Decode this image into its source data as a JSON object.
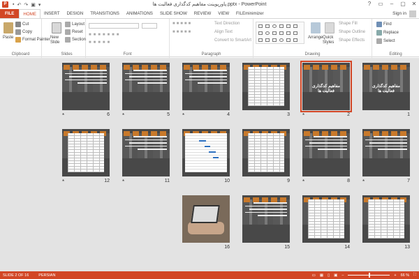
{
  "window": {
    "title": "پاورپوینت مفاهیم کدگذاری فعالیت ها.pptx - PowerPoint",
    "app_icon": "P",
    "controls": [
      "?",
      "▭",
      "–",
      "▢",
      "✕"
    ]
  },
  "tabs": [
    "FILE",
    "HOME",
    "INSERT",
    "DESIGN",
    "TRANSITIONS",
    "ANIMATIONS",
    "SLIDE SHOW",
    "REVIEW",
    "VIEW",
    "FILEminimizer"
  ],
  "active_tab": "HOME",
  "account": {
    "signin": "Sign in"
  },
  "ribbon": {
    "clipboard": {
      "label": "Clipboard",
      "paste": "Paste",
      "cut": "Cut",
      "copy": "Copy",
      "format_painter": "Format Painter"
    },
    "slides": {
      "label": "Slides",
      "new_slide": "New Slide",
      "layout": "Layout",
      "reset": "Reset",
      "section": "Section"
    },
    "font": {
      "label": "Font"
    },
    "paragraph": {
      "label": "Paragraph",
      "text_direction": "Text Direction",
      "align_text": "Align Text",
      "convert": "Convert to SmartArt"
    },
    "drawing": {
      "label": "Drawing",
      "arrange": "Arrange",
      "quick_styles": "Quick Styles",
      "shape_fill": "Shape Fill",
      "shape_outline": "Shape Outline",
      "shape_effects": "Shape Effects"
    },
    "editing": {
      "label": "Editing",
      "find": "Find",
      "replace": "Replace",
      "select": "Select"
    }
  },
  "slides": [
    {
      "n": "1",
      "star": false,
      "kind": "title",
      "title": "مفاهیم کدگذاری فعالیت ها"
    },
    {
      "n": "2",
      "star": true,
      "kind": "title-selected",
      "title": "مفاهیم کدگذاری فعالیت ها"
    },
    {
      "n": "3",
      "star": false,
      "kind": "table"
    },
    {
      "n": "4",
      "star": true,
      "kind": "text"
    },
    {
      "n": "5",
      "star": true,
      "kind": "text"
    },
    {
      "n": "6",
      "star": true,
      "kind": "text"
    },
    {
      "n": "7",
      "star": true,
      "kind": "text"
    },
    {
      "n": "8",
      "star": true,
      "kind": "text"
    },
    {
      "n": "9",
      "star": false,
      "kind": "table"
    },
    {
      "n": "10",
      "star": false,
      "kind": "gantt"
    },
    {
      "n": "11",
      "star": true,
      "kind": "text"
    },
    {
      "n": "12",
      "star": true,
      "kind": "table"
    },
    {
      "n": "13",
      "star": false,
      "kind": "table"
    },
    {
      "n": "14",
      "star": false,
      "kind": "table"
    },
    {
      "n": "15",
      "star": false,
      "kind": "text"
    },
    {
      "n": "16",
      "star": false,
      "kind": "photo"
    }
  ],
  "status": {
    "slide": "SLIDE 2 OF 16",
    "language": "PERSIAN",
    "zoom": "66 %"
  },
  "colors": {
    "accent": "#d24726",
    "canvas": "#e3e3e3"
  }
}
